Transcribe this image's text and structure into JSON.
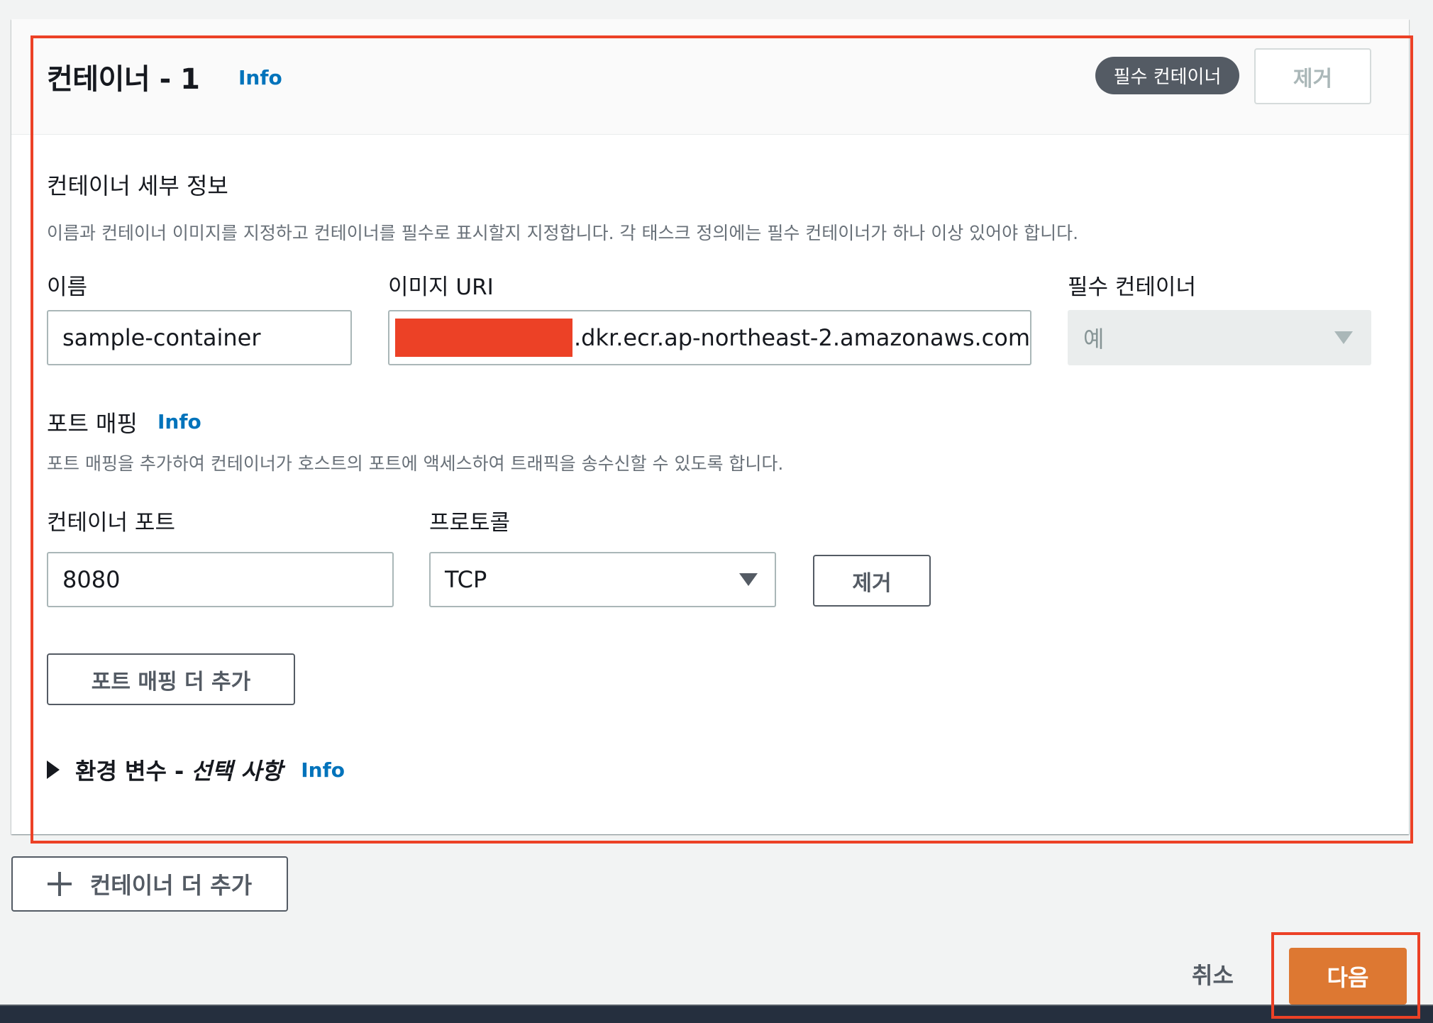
{
  "container": {
    "title": "컨테이너 - 1",
    "info_label": "Info",
    "essential_badge": "필수 컨테이너",
    "remove_container_label": "제거"
  },
  "details": {
    "title": "컨테이너 세부 정보",
    "description": "이름과 컨테이너 이미지를 지정하고 컨테이너를 필수로 표시할지 지정합니다. 각 태스크 정의에는 필수 컨테이너가 하나 이상 있어야 합니다.",
    "name_label": "이름",
    "name_value": "sample-container",
    "image_uri_label": "이미지 URI",
    "image_uri_value": ".dkr.ecr.ap-northeast-2.amazonaws.com",
    "essential_label": "필수 컨테이너",
    "essential_value": "예"
  },
  "port_mapping": {
    "title": "포트 매핑",
    "info_label": "Info",
    "description": "포트 매핑을 추가하여 컨테이너가 호스트의 포트에 액세스하여 트래픽을 송수신할 수 있도록 합니다.",
    "container_port_label": "컨테이너 포트",
    "container_port_value": "8080",
    "protocol_label": "프로토콜",
    "protocol_value": "TCP",
    "remove_label": "제거",
    "add_label": "포트 매핑 더 추가"
  },
  "env_vars": {
    "title": "환경 변수 -",
    "optional": "선택 사항",
    "info_label": "Info"
  },
  "actions": {
    "add_container_label": "컨테이너 더 추가",
    "cancel_label": "취소",
    "next_label": "다음"
  },
  "colors": {
    "primary_button": "#dd7832",
    "info_link": "#0073bb",
    "annotation": "#ec4126",
    "badge": "#545b64"
  }
}
